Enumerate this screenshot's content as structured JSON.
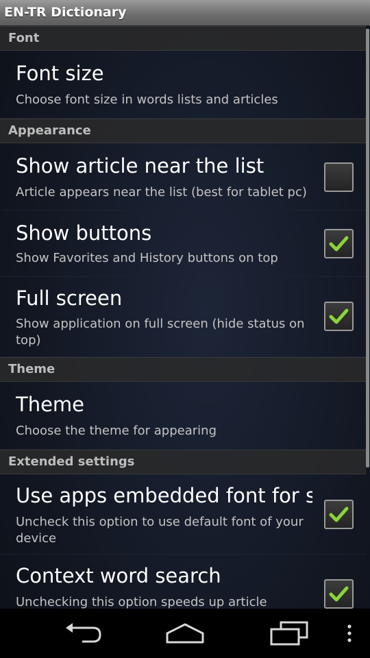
{
  "app": {
    "title": "EN-TR Dictionary"
  },
  "sections": {
    "font": "Font",
    "appearance": "Appearance",
    "theme": "Theme",
    "extended": "Extended settings"
  },
  "items": {
    "font_size": {
      "title": "Font size",
      "summary": "Choose font size in words lists and articles"
    },
    "show_article": {
      "title": "Show article near the list",
      "summary": "Article appears near the list (best for tablet pc)",
      "checked": false
    },
    "show_buttons": {
      "title": "Show buttons",
      "summary": "Show Favorites and History buttons on top",
      "checked": true
    },
    "full_screen": {
      "title": "Full screen",
      "summary": "Show application on full screen (hide status on top)",
      "checked": true
    },
    "theme": {
      "title": "Theme",
      "summary": "Choose the theme for appearing"
    },
    "embedded_font": {
      "title": "Use apps embedded font for s",
      "summary": "Uncheck this option to use default font of your device",
      "checked": true
    },
    "context_search": {
      "title": "Context word search",
      "summary": "Unchecking this option speeds up article",
      "checked": true
    }
  },
  "colors": {
    "check": "#8bd43a",
    "section_bg": "#2a2a2a",
    "title_bar": "#7a7a7a"
  },
  "navbar": {
    "icons": [
      "back-icon",
      "home-icon",
      "recent-apps-icon",
      "menu-icon"
    ]
  }
}
